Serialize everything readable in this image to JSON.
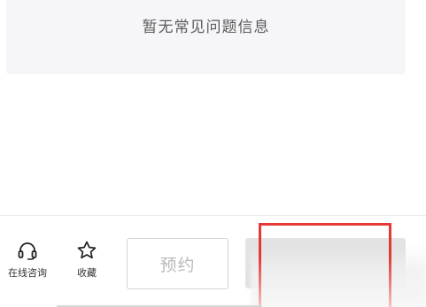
{
  "faq": {
    "empty_text": "暂无常见问题信息"
  },
  "bottom_bar": {
    "consult_label": "在线咨询",
    "consult_icon": "headset-icon",
    "favorite_label": "收藏",
    "favorite_icon": "star-icon",
    "reserve_label": "预约"
  },
  "colors": {
    "highlight_border": "#e53935",
    "disabled_text": "#b9b9b9"
  }
}
